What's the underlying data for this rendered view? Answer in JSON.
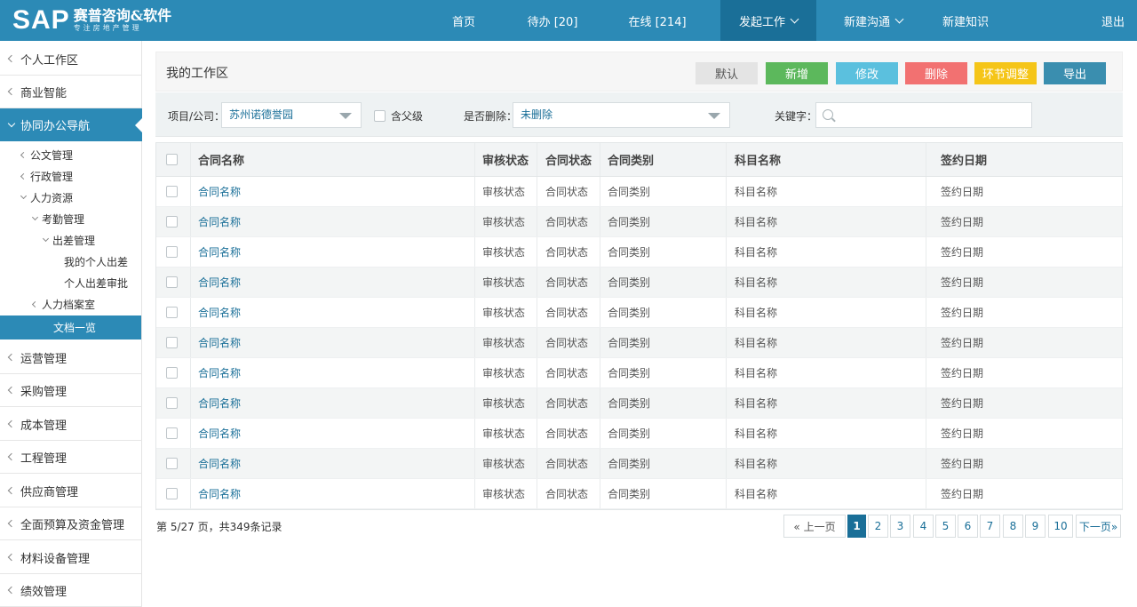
{
  "header": {
    "logo_text": "SAP",
    "logo_cn": "赛普咨询&软件",
    "logo_slogan": "专注房地产管理",
    "nav": [
      {
        "label": "首页"
      },
      {
        "label": "待办 [20]"
      },
      {
        "label": "在线 [214]"
      },
      {
        "label": "发起工作",
        "active": true
      },
      {
        "label": "新建沟通"
      },
      {
        "label": "新建知识"
      },
      {
        "label": "退出"
      }
    ]
  },
  "sidebar": {
    "top_items": [
      {
        "label": "个人工作区"
      },
      {
        "label": "商业智能"
      },
      {
        "label": "协同办公导航",
        "active": true
      },
      {
        "label": "运营管理"
      },
      {
        "label": "采购管理"
      },
      {
        "label": "成本管理"
      },
      {
        "label": "工程管理"
      },
      {
        "label": "供应商管理"
      },
      {
        "label": "全面预算及资金管理"
      },
      {
        "label": "材料设备管理"
      },
      {
        "label": "绩效管理"
      }
    ],
    "sub_items": [
      {
        "label": "公文管理"
      },
      {
        "label": "行政管理"
      },
      {
        "label": "人力资源"
      },
      {
        "label": "考勤管理"
      },
      {
        "label": "出差管理"
      },
      {
        "label": "我的个人出差"
      },
      {
        "label": "个人出差审批"
      },
      {
        "label": "人力档案室"
      },
      {
        "label": "文档一览",
        "active": true
      }
    ]
  },
  "workspace": {
    "title": "我的工作区",
    "buttons": [
      {
        "label": "默认",
        "color": "#e4e4e4"
      },
      {
        "label": "新增",
        "color": "#5cb85c"
      },
      {
        "label": "修改",
        "color": "#5bc0de"
      },
      {
        "label": "删除",
        "color": "#f27171"
      },
      {
        "label": "环节调整",
        "color": "#f5c518"
      },
      {
        "label": "导出",
        "color": "#3a8eaf"
      }
    ]
  },
  "filters": {
    "project_label": "项目/公司：",
    "project_value": "苏州诺德誉园",
    "include_parent_label": "含父级",
    "deleted_label": "是否删除：",
    "deleted_value": "未删除",
    "keyword_label": "关键字：",
    "keyword_placeholder": ""
  },
  "table": {
    "columns": [
      "合同名称",
      "审核状态",
      "合同状态",
      "合同类别",
      "科目名称",
      "签约日期"
    ],
    "rows": [
      [
        "合同名称",
        "审核状态",
        "合同状态",
        "合同类别",
        "科目名称",
        "签约日期"
      ],
      [
        "合同名称",
        "审核状态",
        "合同状态",
        "合同类别",
        "科目名称",
        "签约日期"
      ],
      [
        "合同名称",
        "审核状态",
        "合同状态",
        "合同类别",
        "科目名称",
        "签约日期"
      ],
      [
        "合同名称",
        "审核状态",
        "合同状态",
        "合同类别",
        "科目名称",
        "签约日期"
      ],
      [
        "合同名称",
        "审核状态",
        "合同状态",
        "合同类别",
        "科目名称",
        "签约日期"
      ],
      [
        "合同名称",
        "审核状态",
        "合同状态",
        "合同类别",
        "科目名称",
        "签约日期"
      ],
      [
        "合同名称",
        "审核状态",
        "合同状态",
        "合同类别",
        "科目名称",
        "签约日期"
      ],
      [
        "合同名称",
        "审核状态",
        "合同状态",
        "合同类别",
        "科目名称",
        "签约日期"
      ],
      [
        "合同名称",
        "审核状态",
        "合同状态",
        "合同类别",
        "科目名称",
        "签约日期"
      ],
      [
        "合同名称",
        "审核状态",
        "合同状态",
        "合同类别",
        "科目名称",
        "签约日期"
      ],
      [
        "合同名称",
        "审核状态",
        "合同状态",
        "合同类别",
        "科目名称",
        "签约日期"
      ]
    ]
  },
  "pagination": {
    "info": "第 5/27 页，共349条记录",
    "prev_label": "« 上一页",
    "next_label": "下一页»",
    "pages": [
      "1",
      "2",
      "3",
      "4",
      "5",
      "6",
      "7",
      "8",
      "9",
      "10"
    ],
    "current_page": "1"
  }
}
